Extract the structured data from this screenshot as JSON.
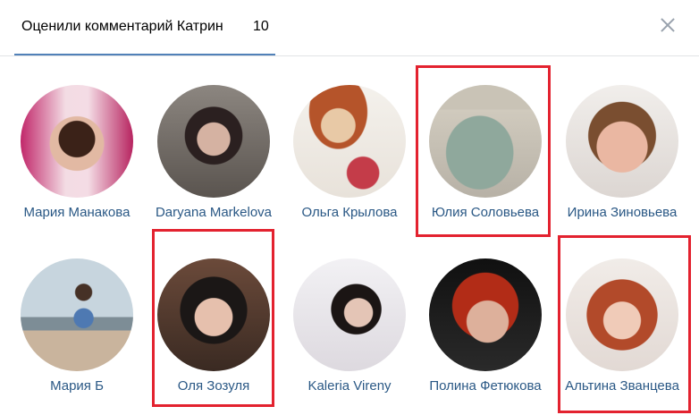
{
  "header": {
    "title": "Оценили комментарий Катрин",
    "count": "10"
  },
  "users": [
    {
      "name": "Мария Манаковa"
    },
    {
      "name": "Daryana Markelova"
    },
    {
      "name": "Ольга Крылова"
    },
    {
      "name": "Юлия Соловьева"
    },
    {
      "name": "Ирина Зиновьева"
    },
    {
      "name": "Мария Б"
    },
    {
      "name": "Оля Зозуля"
    },
    {
      "name": "Kaleria Vireny"
    },
    {
      "name": "Полина Фетюкова"
    },
    {
      "name": "Альтина Званцева"
    }
  ],
  "colors": {
    "link": "#2a5885",
    "tab_underline": "#5181b8",
    "highlight": "#e3222f",
    "close_icon": "#99a2ad"
  }
}
